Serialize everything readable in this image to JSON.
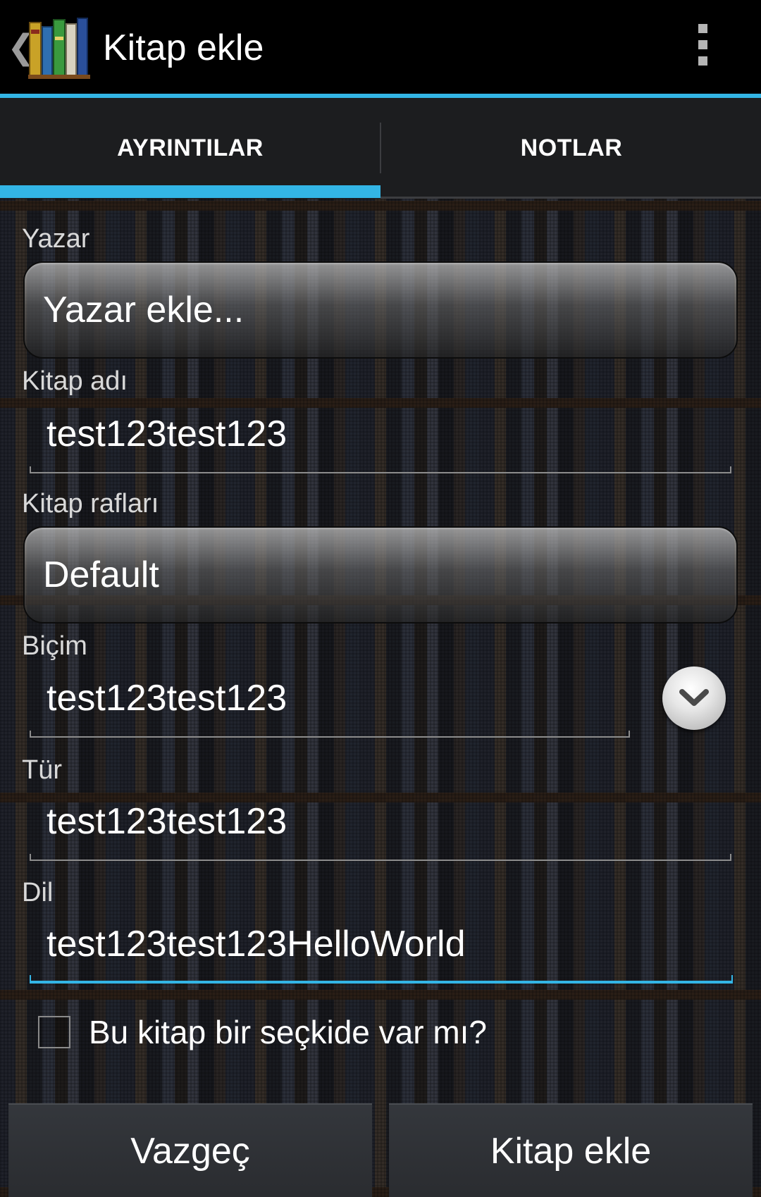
{
  "actionbar": {
    "back_glyph": "❮",
    "logo_icon": "bookshelf-app-icon",
    "title": "Kitap ekle",
    "overflow_icon": "overflow-menu-icon"
  },
  "colors": {
    "accent": "#33b5e5",
    "actionbar_bg": "#000000",
    "tabbar_bg": "#1c1d1f"
  },
  "tabs": [
    {
      "label": "AYRINTILAR",
      "selected": true
    },
    {
      "label": "NOTLAR",
      "selected": false
    }
  ],
  "form": {
    "author": {
      "label": "Yazar",
      "button_text": "Yazar ekle..."
    },
    "title": {
      "label": "Kitap adı",
      "value": "test123test123"
    },
    "shelves": {
      "label": "Kitap rafları",
      "button_text": "Default"
    },
    "format": {
      "label": "Biçim",
      "value": "test123test123",
      "dropdown_icon": "chevron-down-icon"
    },
    "genre": {
      "label": "Tür",
      "value": "test123test123"
    },
    "language": {
      "label": "Dil",
      "value": "test123test123HelloWorld"
    },
    "anthology": {
      "label": "Bu kitap bir seçkide var mı?",
      "checked": false
    }
  },
  "buttons": {
    "cancel": "Vazgeç",
    "add": "Kitap ekle"
  }
}
